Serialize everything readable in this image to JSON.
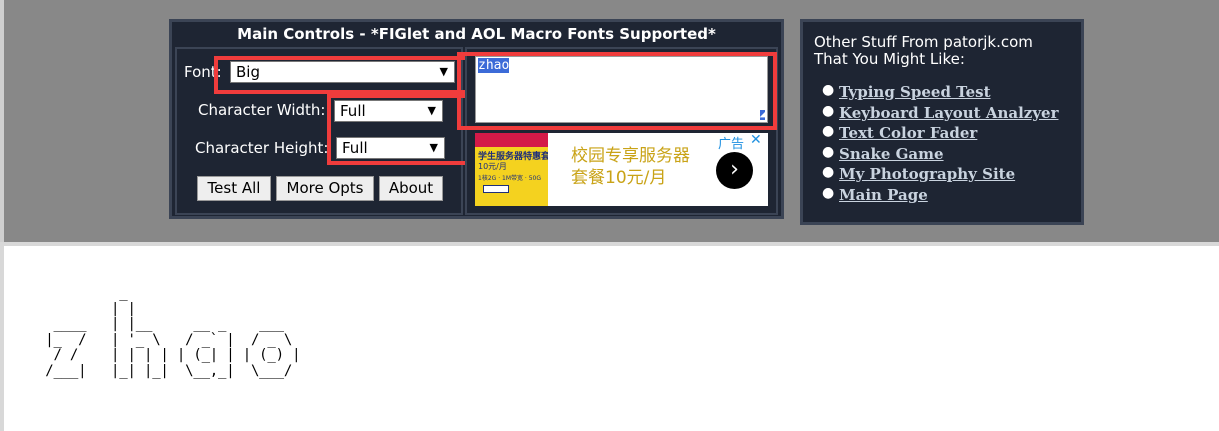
{
  "main_controls": {
    "title": "Main Controls - *FIGlet and AOL Macro Fonts Supported*",
    "font_label": "Font:",
    "font_value": "Big",
    "char_width_label": "Character Width:",
    "char_width_value": "Full",
    "char_height_label": "Character Height:",
    "char_height_value": "Full",
    "buttons": {
      "test_all": "Test All",
      "more_opts": "More Opts",
      "about": "About"
    },
    "text_input_value": "zhao"
  },
  "ad": {
    "image_line1": "学生服务器特惠套",
    "image_line2": "10元/月",
    "image_line3": "1核2G · 1M带宽 · 50G",
    "text_line1": "校园专享服务器",
    "text_line2": "套餐10元/月",
    "label": "广告",
    "close": "✕",
    "next": "›"
  },
  "other_stuff": {
    "intro_line1": "Other Stuff From patorjk.com",
    "intro_line2": "That You Might Like:",
    "links": [
      "Typing Speed Test",
      "Keyboard Layout Analzyer",
      "Text Color Fader",
      "Snake Game",
      "My Photography Site",
      "Main Page"
    ]
  },
  "output": {
    "ascii_art": "          _\n         | |\n  ____   | |__     __ _    ___\n |_  /   | '_ \\   / _` |  / _ \\\n  / /    | | | | | (_| | | (_) |\n /___|   |_| |_|  \\__,_|  \\___/"
  }
}
